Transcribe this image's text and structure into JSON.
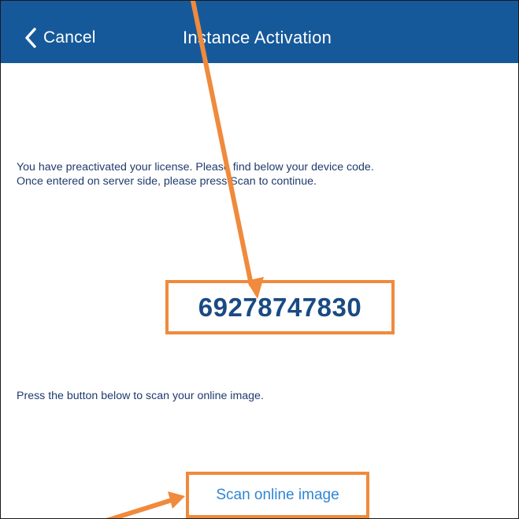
{
  "colors": {
    "navbar_bg": "#16599a",
    "annotation_orange": "#f08a3c",
    "code_text": "#1a4a82",
    "link_blue": "#2e86d4",
    "body_text": "#1f3b6d"
  },
  "navbar": {
    "back_icon": "chevron-left-icon",
    "back_label": "Cancel",
    "title": "Instance Activation"
  },
  "main": {
    "info_line_1": "You have preactivated your license. Please find below your device code.",
    "info_line_2": "Once entered on server side, please press Scan to continue.",
    "device_code": "69278747830",
    "scan_hint": "Press the button below to scan your online image.",
    "scan_button_label": "Scan online image"
  }
}
